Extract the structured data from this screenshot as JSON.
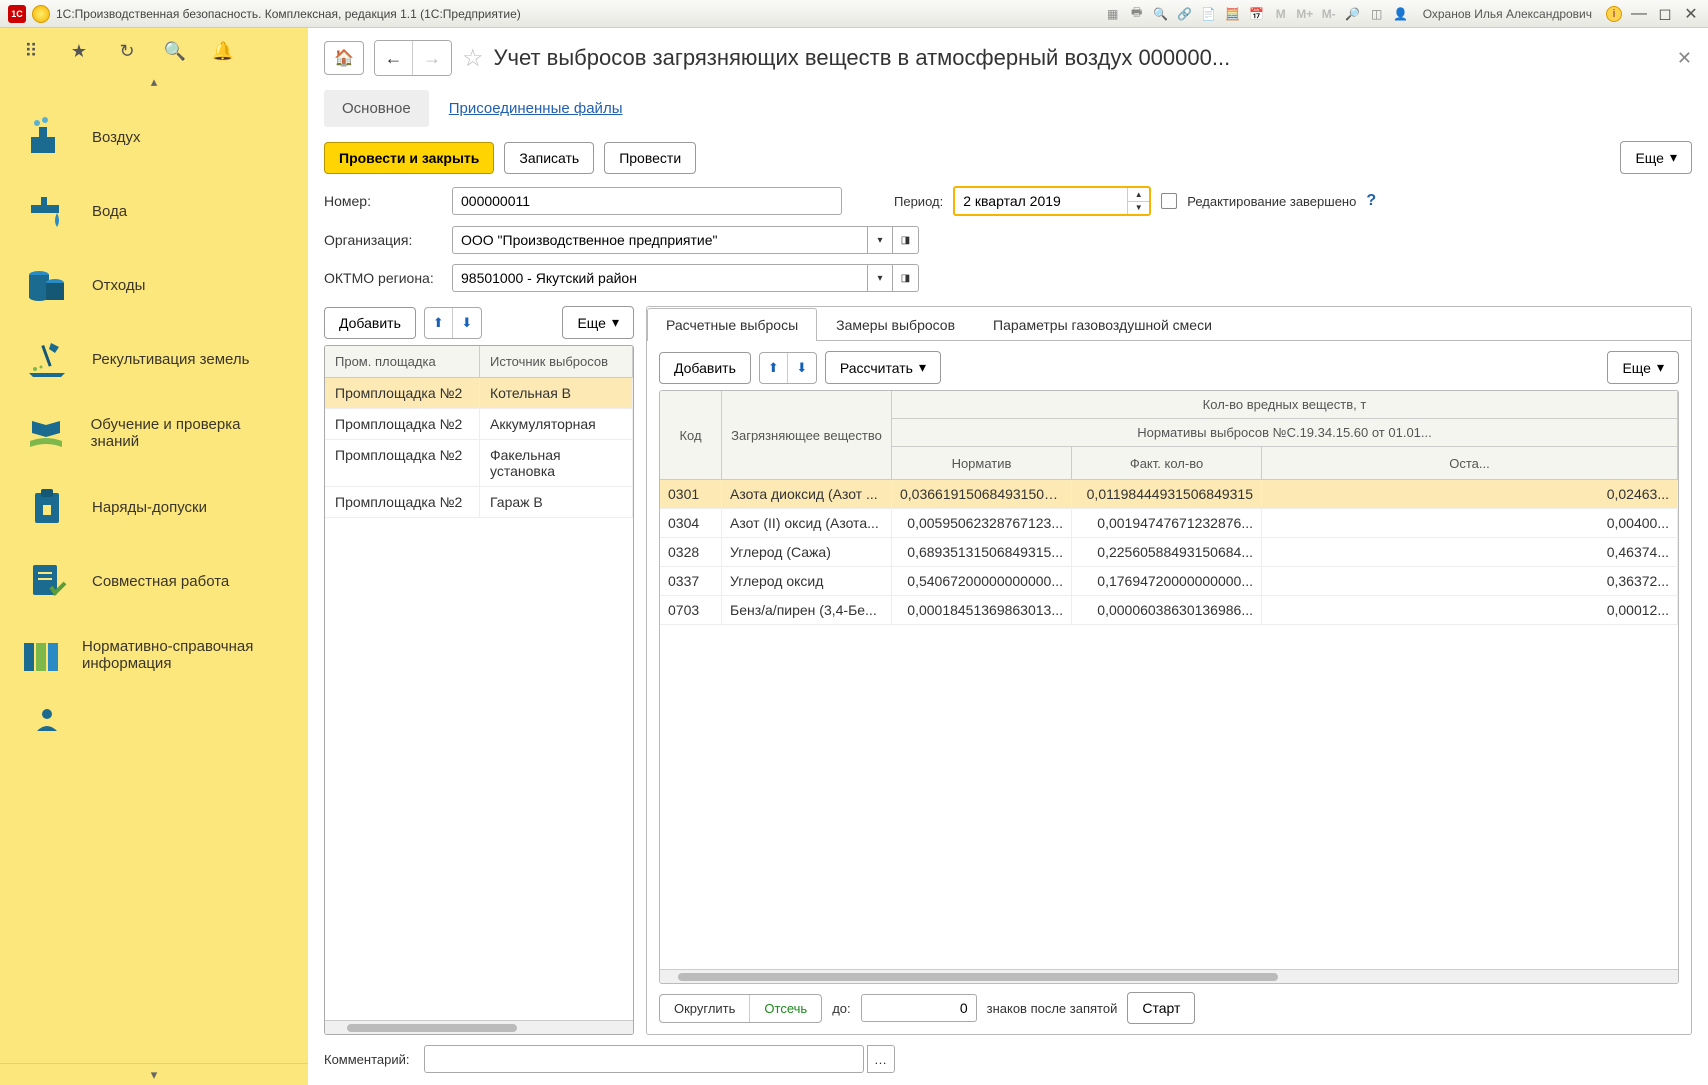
{
  "titlebar": {
    "app_title": "1С:Производственная безопасность. Комплексная, редакция 1.1  (1С:Предприятие)",
    "user": "Охранов Илья Александрович"
  },
  "sidebar": {
    "items": [
      {
        "label": "Воздух"
      },
      {
        "label": "Вода"
      },
      {
        "label": "Отходы"
      },
      {
        "label": "Рекультивация земель"
      },
      {
        "label": "Обучение и проверка знаний"
      },
      {
        "label": "Наряды-допуски"
      },
      {
        "label": "Совместная работа"
      },
      {
        "label": "Нормативно-справочная информация"
      }
    ]
  },
  "page": {
    "title": "Учет выбросов загрязняющих веществ в атмосферный воздух 000000...",
    "tab_main": "Основное",
    "tab_files": "Присоединенные файлы"
  },
  "actions": {
    "post_close": "Провести и закрыть",
    "save": "Записать",
    "post": "Провести",
    "more": "Еще"
  },
  "form": {
    "number_label": "Номер:",
    "number_value": "000000011",
    "period_label": "Период:",
    "period_value": "2 квартал 2019",
    "edit_done": "Редактирование завершено",
    "org_label": "Организация:",
    "org_value": "ООО \"Производственное предприятие\"",
    "oktmo_label": "ОКТМО региона:",
    "oktmo_value": "98501000 - Якутский район",
    "comment_label": "Комментарий:"
  },
  "left_pane": {
    "add": "Добавить",
    "col_site": "Пром. площадка",
    "col_source": "Источник выбросов",
    "rows": [
      {
        "site": "Промплощадка №2",
        "source": "Котельная В"
      },
      {
        "site": "Промплощадка №2",
        "source": "Аккумуляторная"
      },
      {
        "site": "Промплощадка №2",
        "source": "Факельная установка"
      },
      {
        "site": "Промплощадка №2",
        "source": "Гараж В"
      }
    ]
  },
  "right_pane": {
    "tabs": {
      "calc": "Расчетные выбросы",
      "meas": "Замеры выбросов",
      "params": "Параметры газовоздушной смеси"
    },
    "add": "Добавить",
    "calc_btn": "Рассчитать",
    "head_code": "Код",
    "head_poll": "Загрязняющее вещество",
    "head_qty": "Кол-во вредных веществ, т",
    "head_norms": "Нормативы выбросов №С.19.34.15.60 от 01.01...",
    "head_norm": "Норматив",
    "head_fact": "Факт. кол-во",
    "head_rem": "Оста...",
    "rows": [
      {
        "code": "0301",
        "poll": "Азота диоксид (Азот ...",
        "n1": "0,03661915068493150б...",
        "n2": "0,01198444931506849315",
        "n3": "0,02463..."
      },
      {
        "code": "0304",
        "poll": "Азот (II) оксид (Азота...",
        "n1": "0,00595062328767123...",
        "n2": "0,00194747671232876...",
        "n3": "0,00400..."
      },
      {
        "code": "0328",
        "poll": "Углерод (Сажа)",
        "n1": "0,68935131506849315...",
        "n2": "0,22560588493150684...",
        "n3": "0,46374..."
      },
      {
        "code": "0337",
        "poll": "Углерод оксид",
        "n1": "0,54067200000000000...",
        "n2": "0,17694720000000000...",
        "n3": "0,36372..."
      },
      {
        "code": "0703",
        "poll": "Бенз/а/пирен (3,4-Бе...",
        "n1": "0,00018451369863013...",
        "n2": "0,00006038630136986...",
        "n3": "0,00012..."
      }
    ],
    "round": "Округлить",
    "trunc": "Отсечь",
    "to": "до:",
    "digits_val": "0",
    "digits_suffix": "знаков после запятой",
    "start": "Старт"
  }
}
